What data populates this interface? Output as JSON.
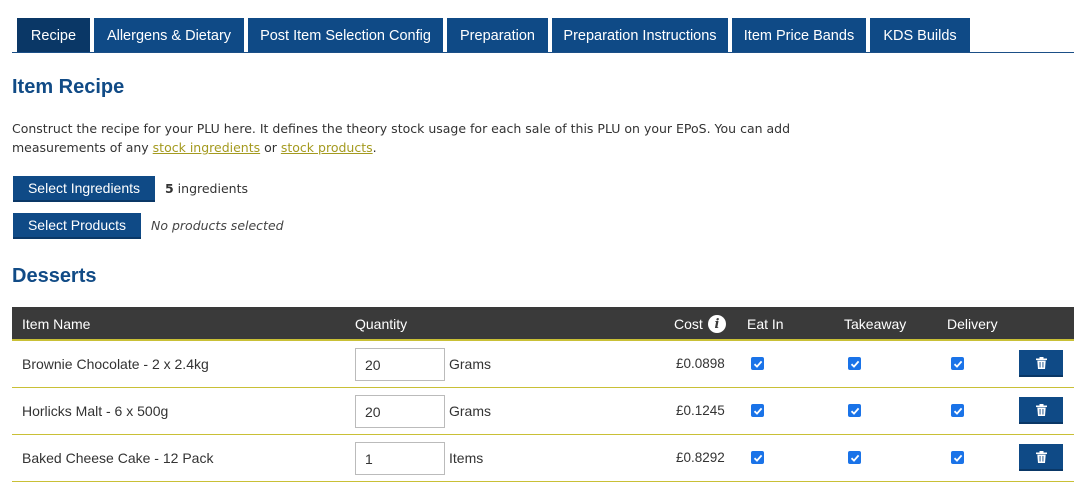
{
  "tabs": [
    {
      "label": "Recipe",
      "active": true
    },
    {
      "label": "Allergens & Dietary"
    },
    {
      "label": "Post Item Selection Config"
    },
    {
      "label": "Preparation"
    },
    {
      "label": "Preparation Instructions"
    },
    {
      "label": "Item Price Bands"
    },
    {
      "label": "KDS Builds"
    }
  ],
  "item_recipe": {
    "title": "Item Recipe",
    "desc_part1": "Construct the recipe for your PLU here. It defines the theory stock usage for each sale of this PLU on your EPoS. You can add measurements of any ",
    "link_ingredients": "stock ingredients",
    "desc_or": " or ",
    "link_products": "stock products",
    "desc_end": "."
  },
  "ingredients": {
    "button_label": "Select Ingredients",
    "count": "5",
    "count_label": " ingredients"
  },
  "products": {
    "button_label": "Select Products",
    "status": "No products selected"
  },
  "section": {
    "title": "Desserts"
  },
  "table": {
    "headers": {
      "item_name": "Item Name",
      "quantity": "Quantity",
      "cost": "Cost",
      "eat_in": "Eat In",
      "takeaway": "Takeaway",
      "delivery": "Delivery"
    },
    "rows": [
      {
        "name": "Brownie Chocolate - 2 x 2.4kg",
        "quantity": "20",
        "unit": "Grams",
        "cost": "£0.0898",
        "eat_in": true,
        "takeaway": true,
        "delivery": true
      },
      {
        "name": "Horlicks Malt - 6 x 500g",
        "quantity": "20",
        "unit": "Grams",
        "cost": "£0.1245",
        "eat_in": true,
        "takeaway": true,
        "delivery": true
      },
      {
        "name": "Baked Cheese Cake - 12 Pack",
        "quantity": "1",
        "unit": "Items",
        "cost": "£0.8292",
        "eat_in": true,
        "takeaway": true,
        "delivery": true
      }
    ]
  },
  "icons": {
    "info": "info-icon",
    "checkbox": "check-icon",
    "delete": "trash-icon"
  },
  "colors": {
    "brand_blue": "#0f4a86",
    "header_dark": "#3a3a3a",
    "accent_line": "#c9c036",
    "link": "#a49a1f"
  }
}
